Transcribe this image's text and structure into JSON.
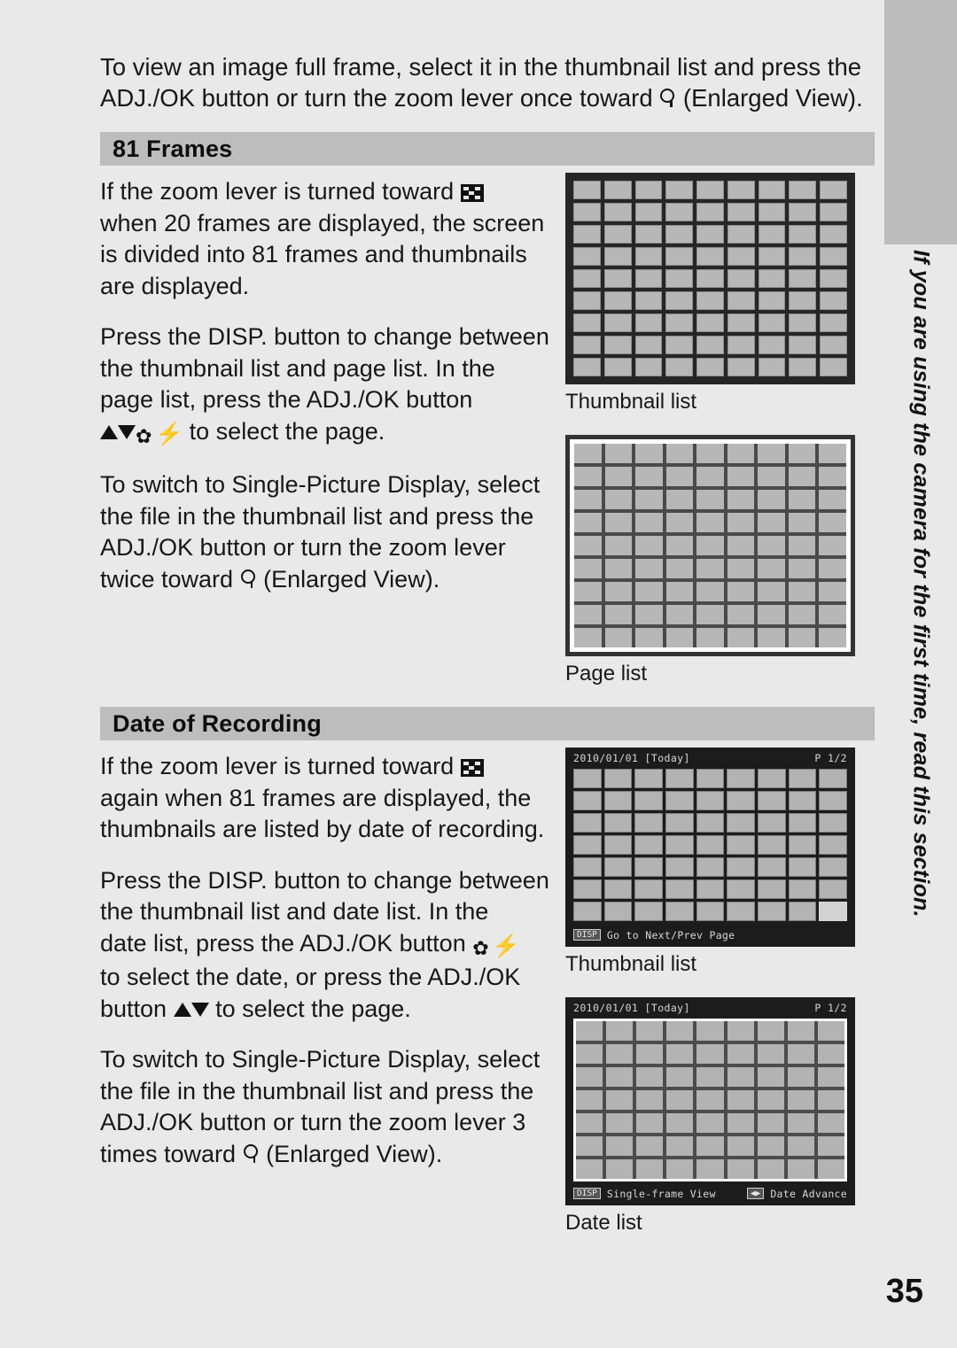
{
  "page": {
    "number": "35",
    "background_color": "#e9e9e9",
    "header_bar_color": "#bdbdbd",
    "tab_color": "#bcbcbc"
  },
  "side_tab_text": "If you are using the camera for the first time, read this section.",
  "intro": {
    "line1": "To view an image full frame, select it in the thumbnail list and press the",
    "line2_a": "ADJ./OK button or turn the zoom lever once toward",
    "line2_b": "(Enlarged View)."
  },
  "sections": [
    {
      "id": "frames81",
      "title": "81 Frames",
      "paragraphs": [
        {
          "lines": [
            "If the zoom lever is turned toward",
            "when 20 frames are displayed, the screen",
            "is divided into 81 frames and thumbnails",
            "are displayed."
          ]
        },
        {
          "lines": [
            "Press the DISP. button to change between",
            "the thumbnail list and page list. In the",
            "page list, press the ADJ./OK button",
            "to select the page."
          ]
        },
        {
          "lines": [
            "To switch to Single-Picture Display, select",
            "the file in the thumbnail list and press the",
            "ADJ./OK button or turn the zoom lever",
            "twice toward",
            "(Enlarged View)."
          ]
        }
      ],
      "figures": [
        {
          "caption": "Thumbnail list",
          "kind": "grid-separated",
          "cols": 9,
          "rows": 9
        },
        {
          "caption": "Page list",
          "kind": "grid-selected",
          "cols": 9,
          "rows": 9
        }
      ]
    },
    {
      "id": "date-of-recording",
      "title": "Date of Recording",
      "paragraphs": [
        {
          "lines": [
            "If the zoom lever is turned toward",
            "again when 81 frames are displayed, the",
            "thumbnails are listed by date of recording."
          ]
        },
        {
          "lines": [
            "Press the DISP. button to change between",
            "the thumbnail list and date list. In the",
            "date list, press the ADJ./OK button",
            "to select the date, or press the ADJ./OK",
            "button",
            "to select the page."
          ]
        },
        {
          "lines": [
            "To switch to Single-Picture Display, select",
            "the file in the thumbnail list and press the",
            "ADJ./OK button or turn the zoom lever 3",
            "times toward",
            "(Enlarged View)."
          ]
        }
      ],
      "figures": [
        {
          "caption": "Thumbnail list",
          "kind": "lcd-thumbnail",
          "cols": 9,
          "rows": 7,
          "topbar_left": "2010/01/01 [Today]",
          "topbar_right": "P 1/2",
          "botbar_key": "DISP",
          "botbar_text": "Go to Next/Prev Page"
        },
        {
          "caption": "Date list",
          "kind": "lcd-date",
          "cols": 9,
          "rows": 7,
          "topbar_left": "2010/01/01 [Today]",
          "topbar_right": "P 1/2",
          "botbar_key": "DISP",
          "botbar_text": "Single-frame View",
          "botbar_key2": "◀▶",
          "botbar_text2": "Date Advance"
        }
      ]
    }
  ],
  "icons": {
    "zoom": "magnifier-icon",
    "thumbnail": "checkerboard-thumbnail-icon",
    "up": "up-arrow-icon",
    "down": "down-arrow-icon",
    "macro": "macro-flower-icon",
    "flash": "flash-bolt-icon"
  }
}
